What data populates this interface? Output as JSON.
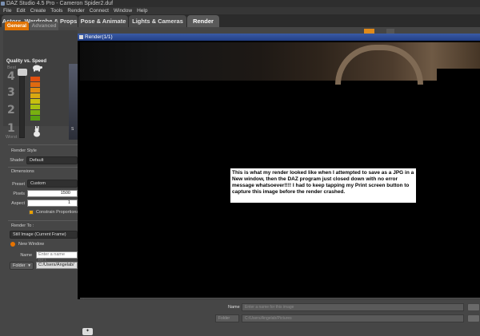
{
  "app": {
    "title": "DAZ Studio 4.5 Pro - Cameron Spider2.duf",
    "menu": [
      "File",
      "Edit",
      "Create",
      "Tools",
      "Render",
      "Connect",
      "Window",
      "Help"
    ]
  },
  "tabs": [
    {
      "label": "Actors, Wardrobe & Props",
      "active": false
    },
    {
      "label": "Pose & Animate",
      "active": false
    },
    {
      "label": "Lights & Cameras",
      "active": false
    },
    {
      "label": "Render",
      "active": true
    }
  ],
  "left_panel": {
    "tab_general": "General",
    "tab_advanced": "Advanced",
    "quality_label": "Quality vs. Speed",
    "best_label": "Best",
    "worst_label": "Worst",
    "levels": [
      "4",
      "3",
      "2",
      "1"
    ],
    "meter_colors": [
      "#e05010",
      "#e06a10",
      "#e08a10",
      "#d8a810",
      "#c8c010",
      "#a8c010",
      "#78b010",
      "#58a010"
    ],
    "preview_label": "S",
    "render_style": "Render Style",
    "shader_label": "Shader",
    "shader_value": "Default",
    "dimensions_label": "Dimensions",
    "preset_label": "Preset",
    "preset_value": "Custom",
    "pixels_label": "Pixels",
    "pixels_value": "1500",
    "aspect_label": "Aspect",
    "aspect_value": "1",
    "constrain_label": "Constrain Proportions",
    "render_to_label": "Render To :",
    "render_to_value": "Still Image (Current Frame)",
    "new_window_label": "New Window",
    "name_label": "Name",
    "name_placeholder": "Enter a name for t",
    "folder_button": "Folder",
    "folder_value": "C:/Users/Angelab/"
  },
  "render_window": {
    "title": "Render(1/1)",
    "note": "This is what my render looked like when I attempted to save as a JPG in a New window, then the DAZ program just closed down with no error message whatsoever!!!! I had to keep tapping my Print screen button to capture this image before the render crashed."
  },
  "bottom": {
    "name_label": "Name",
    "name_placeholder": "Enter a name for this image",
    "folder_button": "Folder",
    "folder_value": "C:/Users/Angelab/Pictures"
  }
}
